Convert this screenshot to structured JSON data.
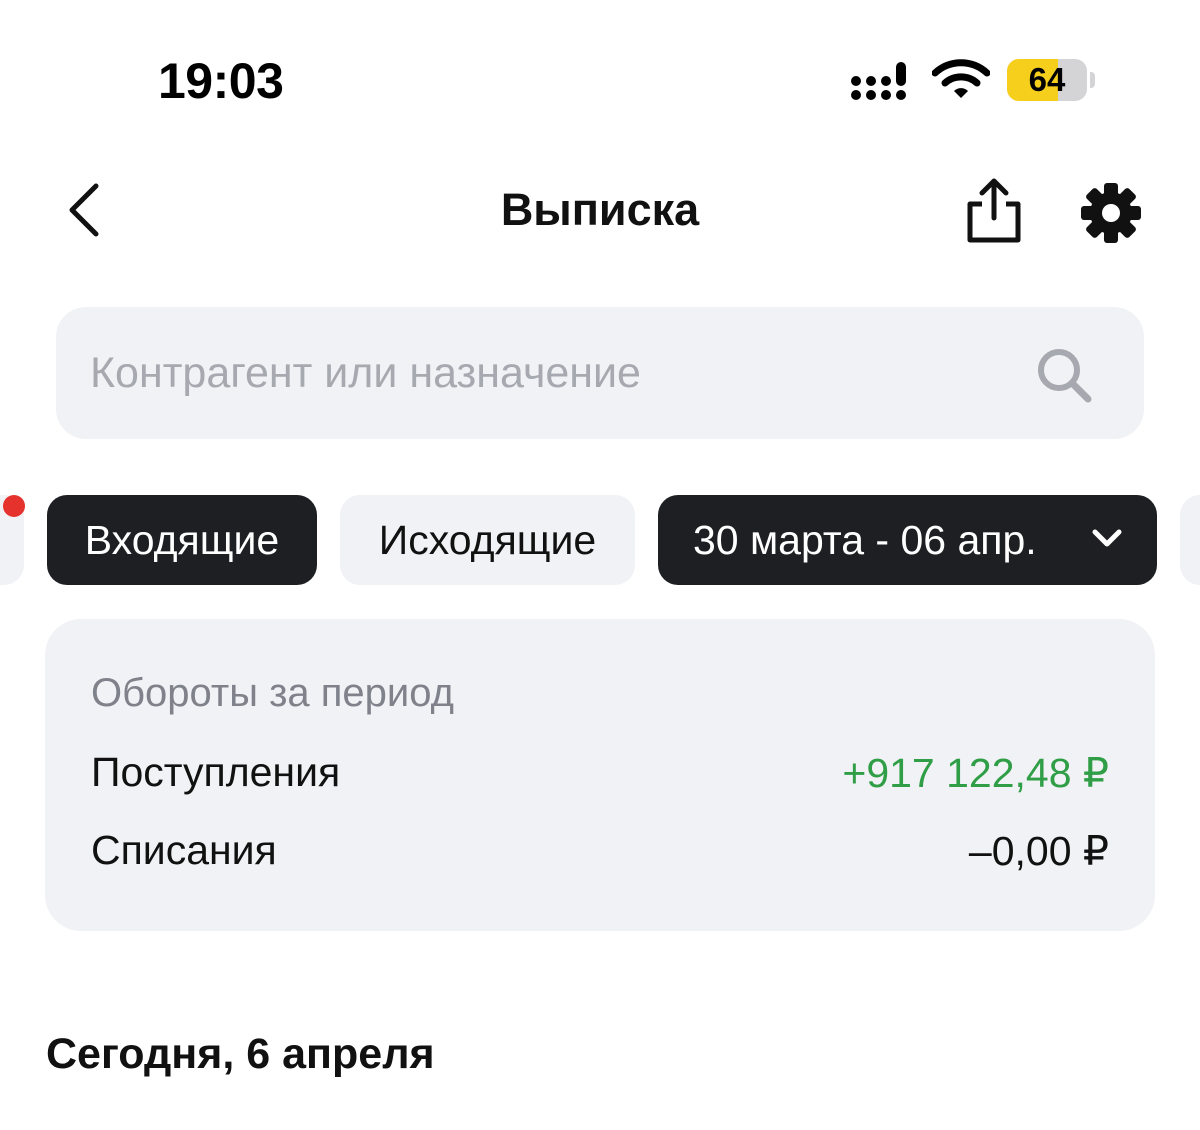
{
  "status_bar": {
    "time": "19:03",
    "battery_percent": 64,
    "battery_label": "64",
    "icons": [
      "signal-icon",
      "wifi-icon",
      "battery-icon"
    ]
  },
  "nav": {
    "title": "Выписка",
    "back_icon": "chevron-left-icon",
    "share_icon": "share-icon",
    "settings_icon": "gear-icon"
  },
  "search": {
    "value": "",
    "placeholder": "Контрагент или назначение",
    "icon": "search-icon"
  },
  "filters": {
    "incoming_label": "Входящие",
    "outgoing_label": "Исходящие",
    "period_label": "30 марта - 06 апр.",
    "selected": [
      "Входящие",
      "30 марта - 06 апр."
    ]
  },
  "summary": {
    "heading": "Обороты за период",
    "income_label": "Поступления",
    "income_value": "+917 122,48 ₽",
    "outcome_label": "Списания",
    "outcome_value": "–0,00 ₽"
  },
  "transactions": {
    "date_header": "Сегодня, 6 апреля"
  },
  "colors": {
    "accent_yellow": "#f6cf1d",
    "positive_green": "#2f9e46",
    "chip_dark": "#1e1f23",
    "surface_gray": "#f1f2f5",
    "notify_red": "#e5322d"
  }
}
